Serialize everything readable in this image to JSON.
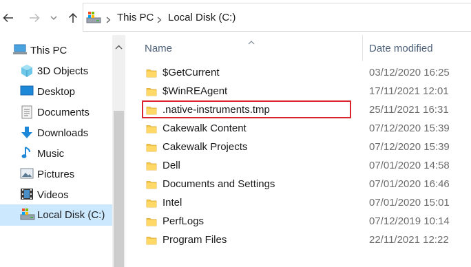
{
  "address": {
    "crumbs": [
      "This PC",
      "Local Disk (C:)"
    ]
  },
  "sidebar": {
    "items": [
      {
        "label": "This PC",
        "icon": "this-pc-icon"
      },
      {
        "label": "3D Objects",
        "icon": "3d-objects-icon"
      },
      {
        "label": "Desktop",
        "icon": "desktop-icon"
      },
      {
        "label": "Documents",
        "icon": "documents-icon"
      },
      {
        "label": "Downloads",
        "icon": "downloads-icon"
      },
      {
        "label": "Music",
        "icon": "music-icon"
      },
      {
        "label": "Pictures",
        "icon": "pictures-icon"
      },
      {
        "label": "Videos",
        "icon": "videos-icon"
      },
      {
        "label": "Local Disk (C:)",
        "icon": "local-disk-icon",
        "selected": true
      }
    ]
  },
  "columns": {
    "name": "Name",
    "date_modified": "Date modified"
  },
  "files": [
    {
      "name": "$GetCurrent",
      "date": "03/12/2020 16:25"
    },
    {
      "name": "$WinREAgent",
      "date": "17/11/2021 12:01"
    },
    {
      "name": ".native-instruments.tmp",
      "date": "25/11/2021 16:31",
      "highlighted": true
    },
    {
      "name": "Cakewalk Content",
      "date": "07/12/2020 15:39"
    },
    {
      "name": "Cakewalk Projects",
      "date": "07/12/2020 15:39"
    },
    {
      "name": "Dell",
      "date": "07/01/2020 14:58"
    },
    {
      "name": "Documents and Settings",
      "date": "07/01/2020 16:46"
    },
    {
      "name": "Intel",
      "date": "07/01/2020 15:01"
    },
    {
      "name": "PerfLogs",
      "date": "07/12/2019 10:14"
    },
    {
      "name": "Program Files",
      "date": "22/11/2021 12:22"
    }
  ],
  "colors": {
    "selected_bg": "#cce8ff",
    "highlight_border": "#d9232d",
    "folder": "#f5c84c"
  }
}
